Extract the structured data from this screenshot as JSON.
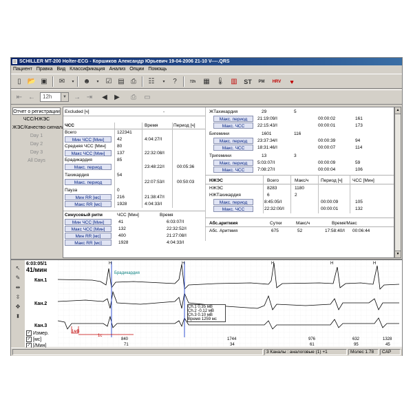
{
  "window": {
    "title": "SCHILLER MT-200 Holter-ECG - Коршиков Александр Юрьевич 19-04-2006 21-10 V----.QRS"
  },
  "menu": [
    "Пациент",
    "Правка",
    "Вид",
    "Классификация",
    "Анализ",
    "Опции",
    "Помощь"
  ],
  "toolbar": {
    "buttons": [
      "new-doc",
      "open-folder",
      "save-disk",
      "envelope",
      "patient-head",
      "checkbox-edit",
      "notes",
      "printer",
      "page-setup",
      "tree-list",
      "help-arrow",
      "hr-72h",
      "grid-table",
      "thermo",
      "bars",
      "st",
      "pm",
      "hrv",
      "heart-hrx"
    ],
    "st_label": "ST",
    "pm_label": "PM",
    "hrv_label": "HRV",
    "hrx_label": "НКХ",
    "hr72_label": "72h",
    "zoom_value": "12h"
  },
  "nav": {
    "items": [
      {
        "label": "Отчет о регистрации",
        "state": "active"
      },
      {
        "label": "ЧСС/НЖЭС",
        "state": "normal"
      },
      {
        "label": "ЖЭС/Качество сигнала",
        "state": "normal"
      },
      {
        "label": "Day 1",
        "state": "disabled"
      },
      {
        "label": "Day 2",
        "state": "disabled"
      },
      {
        "label": "Day 3",
        "state": "disabled"
      },
      {
        "label": "All Days",
        "state": "disabled"
      }
    ]
  },
  "report": {
    "excluded_label": "Excluded [ч]",
    "excluded_value": "-",
    "hr": {
      "header": "ЧСС",
      "col_time": "Время",
      "col_period": "Период [ч]",
      "total_label": "Всего",
      "total_value": "122341",
      "min_btn": "Мин ЧСС [Мин]",
      "min_value": "42",
      "min_time": "4:04:27/I",
      "avg_label": "Средняя ЧСС [Мин]",
      "avg_value": "80",
      "max_btn": "Макс ЧСС [Мин]",
      "max_value": "137",
      "max_time": "22:32:08/I",
      "brady_label": "Брадикардия",
      "brady_value": "85",
      "brady_period_btn": "Макс. период",
      "brady_time": "23:48:22/I",
      "brady_period": "00:05:36",
      "tachy_label": "Тахикардия",
      "tachy_value": "54",
      "tachy_period_btn": "Макс. период",
      "tachy_time": "22:07:53/I",
      "tachy_period": "00:50:03",
      "pause_label": "Пауза",
      "pause_value": "0",
      "minrr_btn": "Мин RR [мс]",
      "minrr_value": "216",
      "minrr_time": "21:38:47/I",
      "maxrr_btn": "Макс RR [мс]",
      "maxrr_value": "1928",
      "maxrr_time": "4:04:33/I"
    },
    "sinus": {
      "header": "Синусовый ритм",
      "col_hr": "ЧСС [Мин]",
      "col_time": "Время",
      "rows": [
        {
          "btn": "Мин ЧСС [Мин]",
          "value": "41",
          "time": "6:03:07/I"
        },
        {
          "btn": "Макс ЧСС [Мин]",
          "value": "132",
          "time": "22:32:52/I"
        },
        {
          "btn": "Мин RR [мс]",
          "value": "400",
          "time": "21:27:08/I"
        },
        {
          "btn": "Макс RR [мс]",
          "value": "1928",
          "time": "4:04:33/I"
        }
      ]
    },
    "vt": {
      "label": "ЖТахикардия",
      "count": "29",
      "per_hour": "5",
      "rows": [
        {
          "btn": "Макс. период",
          "time": "21:19:09/I",
          "period": "00:00:02",
          "hr": "161"
        },
        {
          "btn": "Макс. ЧСС",
          "time": "22:15:43/I",
          "period": "00:00:01",
          "hr": "173"
        }
      ],
      "bigem_label": "Бигемини",
      "bigem_count": "1601",
      "bigem_per_hour": "116",
      "bigem_rows": [
        {
          "btn": "Макс. период",
          "time": "23:37:34/I",
          "period": "00:00:39",
          "hr": "94"
        },
        {
          "btn": "Макс. ЧСС",
          "time": "18:31:46/I",
          "period": "00:00:07",
          "hr": "114"
        }
      ],
      "trig_label": "Тригемини",
      "trig_count": "13",
      "trig_per_hour": "3",
      "trig_rows": [
        {
          "btn": "Макс. период",
          "time": "5:03:07/I",
          "period": "00:00:09",
          "hr": "59"
        },
        {
          "btn": "Макс. ЧСС",
          "time": "7:08:27/I",
          "period": "00:00:04",
          "hr": "106"
        }
      ]
    },
    "svpb": {
      "header": "НЖЭС",
      "col_total": "Всего",
      "col_per_hour": "Макс/ч",
      "col_period": "Период [ч]",
      "col_hr": "ЧСС [Мин]",
      "nzhes_label": "НЖЭС",
      "nzhes_total": "8283",
      "nzhes_per_hour": "1180",
      "nzht_label": "НЖТахикардия",
      "nzht_total": "6",
      "nzht_per_hour": "2",
      "rows": [
        {
          "btn": "Макс. период",
          "time": "8:45:05/I",
          "period": "00:00:09",
          "hr": "105"
        },
        {
          "btn": "Макс. ЧСС",
          "time": "22:32:00/I",
          "period": "00:00:01",
          "hr": "132"
        }
      ]
    },
    "af": {
      "header": "Абс.аритмия",
      "col_days": "Сутки",
      "col_per_hour": "Макс/ч",
      "col_time": "Время/Макс",
      "label": "Абс. Аритмия",
      "days": "675",
      "per_hour": "52",
      "time": "17:58:40/I",
      "period": "00:06:44"
    }
  },
  "ecg": {
    "time": "6:03:05/1",
    "hr": "41/мин",
    "channels": [
      "Кан.1",
      "Кан.2",
      "Кан.3"
    ],
    "annotation": "Брадикардия",
    "beat_label": "H",
    "calib": "1с",
    "calib_label": "1мВ",
    "checkboxes": [
      {
        "label": "Измер.",
        "checked": "✓"
      },
      {
        "label": "[мс]",
        "checked": "✓"
      },
      {
        "label": "[/Мин]",
        "checked": "✓"
      }
    ],
    "rr_values": [
      "840",
      "1744",
      "976",
      "632",
      "1328"
    ],
    "hr_values": [
      "71",
      "34",
      "61",
      "95",
      "45"
    ],
    "tooltip": {
      "rows": [
        {
          "ch": "Ch.1",
          "val": "0.35",
          "unit": "мВ"
        },
        {
          "ch": "Ch.2",
          "val": "-0.12",
          "unit": "мВ"
        },
        {
          "ch": "Ch.3",
          "val": "0.10",
          "unit": "мВ"
        },
        {
          "ch": "Время",
          "val": "1259",
          "unit": "мс"
        }
      ]
    }
  },
  "status": {
    "channels": "3 Каналы : аналоговые (1) +1",
    "module": "Молес 1.78",
    "caps": "CAP"
  }
}
